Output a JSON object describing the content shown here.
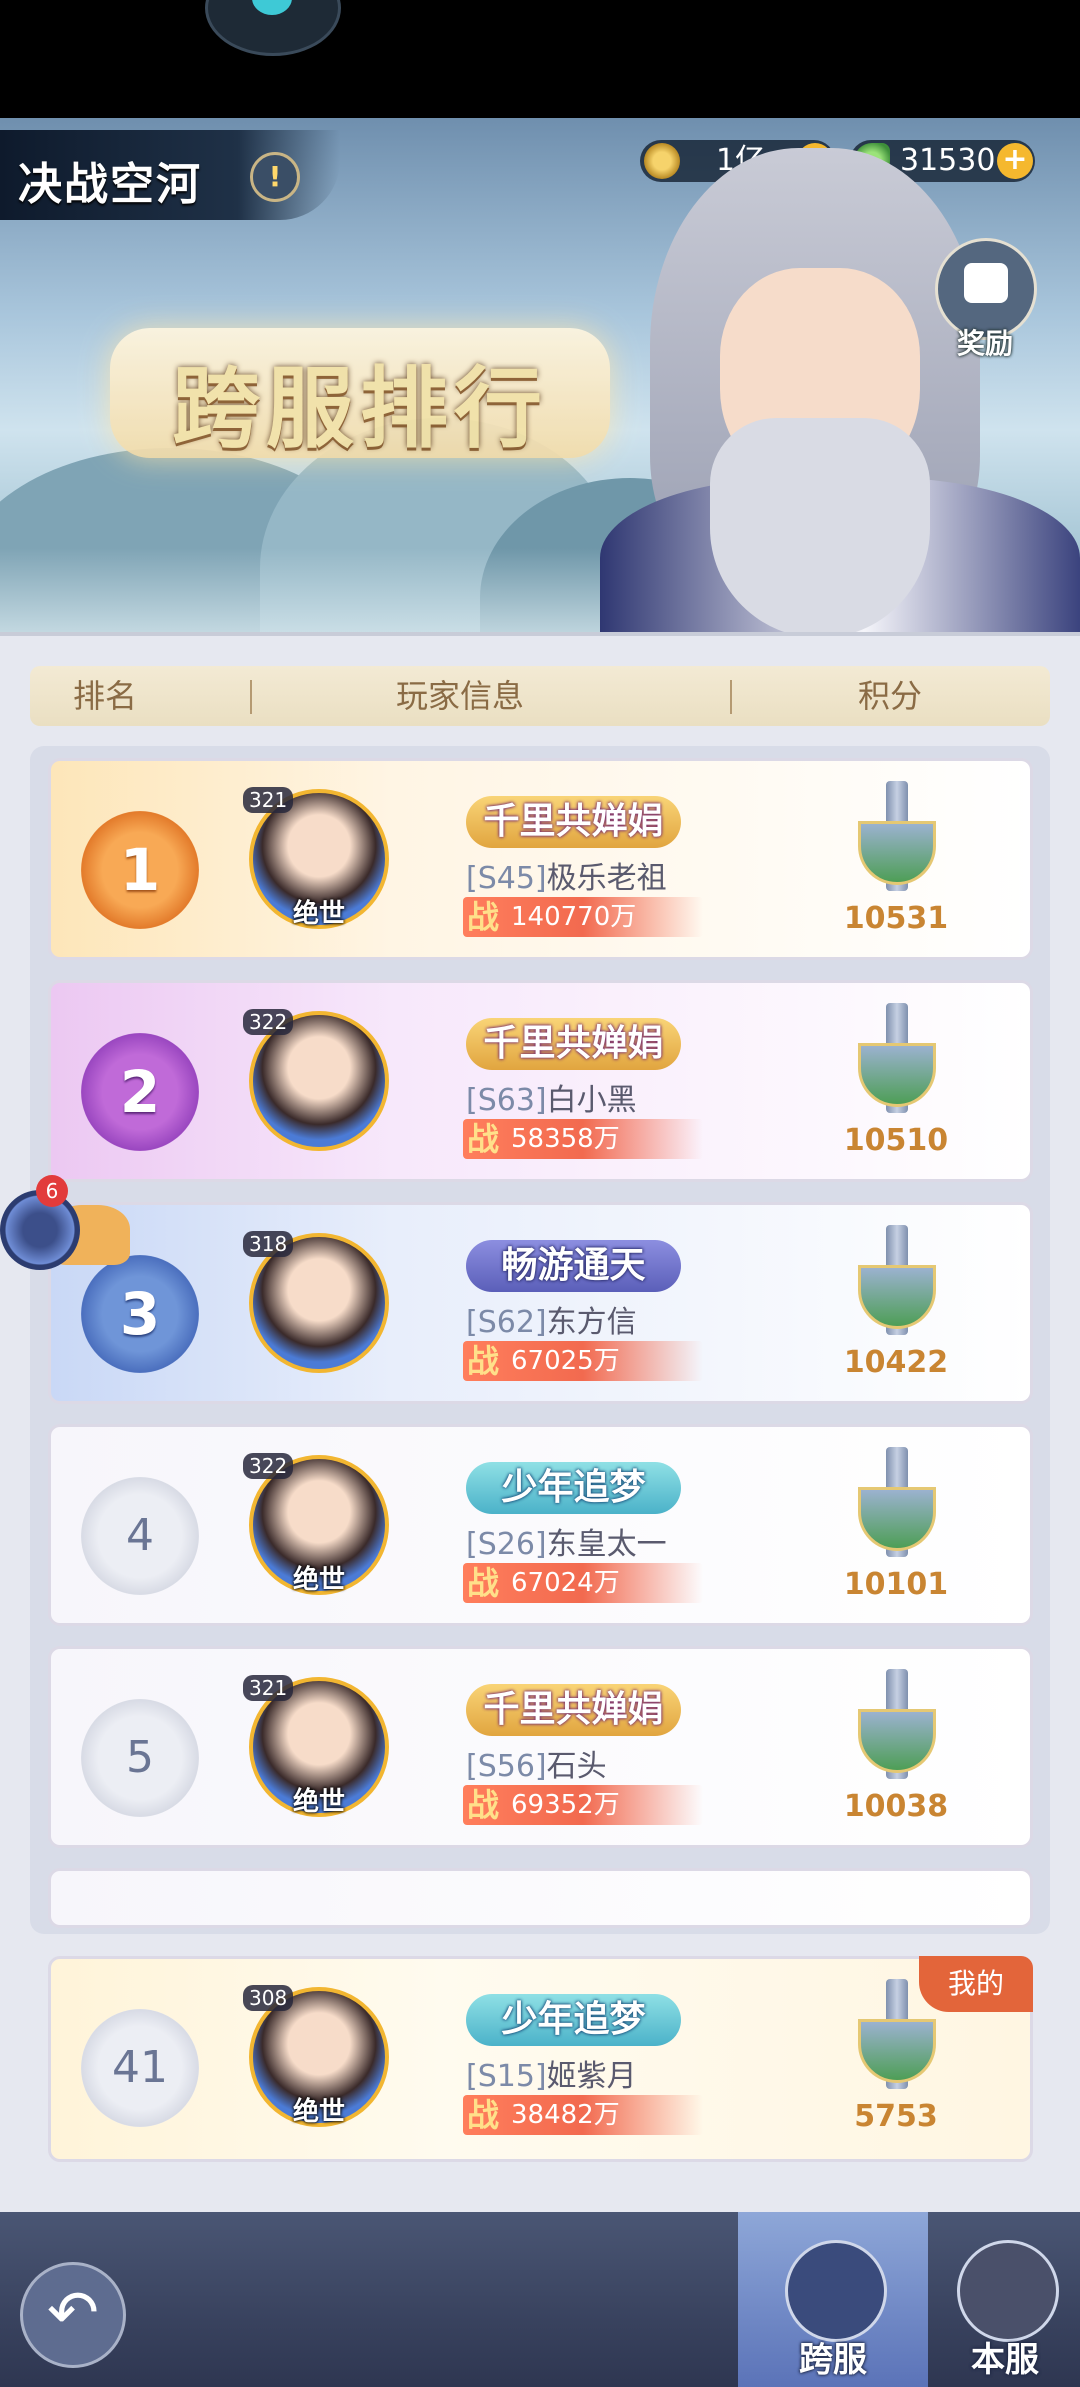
{
  "header": {
    "title": "决战空河",
    "help_icon": "info-icon",
    "currency": [
      {
        "icon": "coin-icon",
        "value": "1亿"
      },
      {
        "icon": "leaf-icon",
        "value": "31530"
      }
    ],
    "reward_label": "奖励",
    "banner_title": "跨服排行"
  },
  "table_header": {
    "rank": "排名",
    "player_info": "玩家信息",
    "score": "积分"
  },
  "rows": [
    {
      "rank": "1",
      "level": "321",
      "title_tag": "绝世",
      "guild": "千里共婵娟",
      "server": "[S45]",
      "name": "极乐老祖",
      "power_label": "战",
      "power": "140770万",
      "score": "10531"
    },
    {
      "rank": "2",
      "level": "322",
      "title_tag": "",
      "guild": "千里共婵娟",
      "server": "[S63]",
      "name": "白小黑",
      "power_label": "战",
      "power": "58358万",
      "score": "10510"
    },
    {
      "rank": "3",
      "level": "318",
      "title_tag": "",
      "guild": "畅游通天",
      "server": "[S62]",
      "name": "东方信",
      "power_label": "战",
      "power": "67025万",
      "score": "10422"
    },
    {
      "rank": "4",
      "level": "322",
      "title_tag": "绝世",
      "guild": "少年追梦",
      "server": "[S26]",
      "name": "东皇太一",
      "power_label": "战",
      "power": "67024万",
      "score": "10101"
    },
    {
      "rank": "5",
      "level": "321",
      "title_tag": "绝世",
      "guild": "千里共婵娟",
      "server": "[S56]",
      "name": "石头",
      "power_label": "战",
      "power": "69352万",
      "score": "10038"
    }
  ],
  "my_row": {
    "badge": "我的",
    "rank": "41",
    "level": "308",
    "title_tag": "绝世",
    "guild": "少年追梦",
    "server": "[S15]",
    "name": "姬紫月",
    "power_label": "战",
    "power": "38482万",
    "score": "5753"
  },
  "snail": {
    "badge": "6"
  },
  "bottom_nav": {
    "back_icon": "back-arrow-icon",
    "tab_cross": "跨服",
    "tab_local": "本服"
  }
}
